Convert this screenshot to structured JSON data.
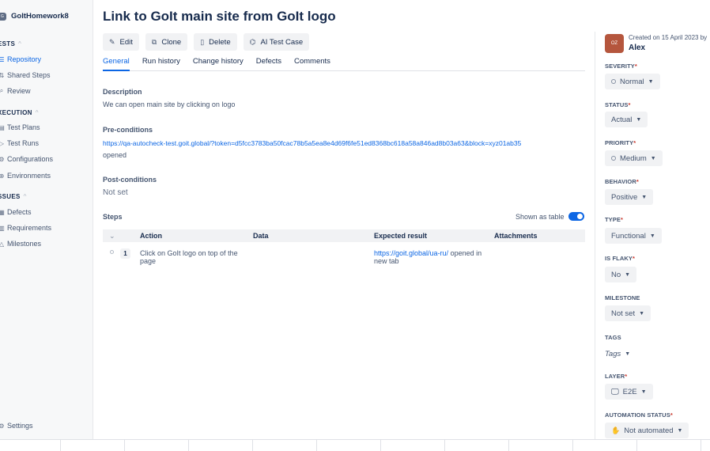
{
  "sidebar": {
    "project": {
      "badge": "G",
      "name": "GoItHomework8"
    },
    "sections": {
      "tests": "ESTS",
      "execution": "XECUTION",
      "issues": "SSUES"
    },
    "tests_items": [
      {
        "label": "Repository",
        "icon": "list-icon",
        "glyph": "☰",
        "active": true
      },
      {
        "label": "Shared Steps",
        "icon": "shared-steps-icon",
        "glyph": "⇅",
        "active": false
      },
      {
        "label": "Review",
        "icon": "review-icon",
        "glyph": "⌕",
        "active": false
      }
    ],
    "execution_items": [
      {
        "label": "Test Plans",
        "icon": "test-plans-icon",
        "glyph": "▤"
      },
      {
        "label": "Test Runs",
        "icon": "test-runs-icon",
        "glyph": "▷"
      },
      {
        "label": "Configurations",
        "icon": "configurations-icon",
        "glyph": "⚙"
      },
      {
        "label": "Environments",
        "icon": "environments-icon",
        "glyph": "⊕"
      }
    ],
    "issues_items": [
      {
        "label": "Defects",
        "icon": "defects-icon",
        "glyph": "▦"
      },
      {
        "label": "Requirements",
        "icon": "requirements-icon",
        "glyph": "▥"
      },
      {
        "label": "Milestones",
        "icon": "milestones-icon",
        "glyph": "△"
      }
    ],
    "settings": {
      "label": "Settings",
      "icon": "settings-icon",
      "glyph": "⚙"
    }
  },
  "page": {
    "title": "Link to GoIt main site from GoIt logo",
    "toolbar": {
      "edit": "Edit",
      "clone": "Clone",
      "delete": "Delete",
      "ai": "AI Test Case"
    },
    "tabs": [
      "General",
      "Run history",
      "Change history",
      "Defects",
      "Comments"
    ],
    "active_tab": "General",
    "description": {
      "label": "Description",
      "text": "We can open main site by clicking on logo"
    },
    "preconditions": {
      "label": "Pre-conditions",
      "link": "https://qa-autocheck-test.goit.global/?token=d5fcc3783ba50fcac78b5a5ea8e4d69f6fe51ed8368bc618a58a846ad8b03a63&block=xyz01ab35",
      "text": "opened"
    },
    "postconditions": {
      "label": "Post-conditions",
      "text": "Not set"
    },
    "steps": {
      "label": "Steps",
      "toggle_label": "Shown as table",
      "toggle_on": true,
      "columns": {
        "action": "Action",
        "data": "Data",
        "expected": "Expected result",
        "attachments": "Attachments"
      },
      "rows": [
        {
          "num": "1",
          "action": "Click on GoIt logo on top of the page",
          "data": "",
          "expected_link": "https://goit.global/ua-ru/",
          "expected_text": " opened in new tab"
        }
      ]
    }
  },
  "panel": {
    "avatar": "OZ",
    "created": "Created on 15 April 2023 by",
    "author": "Alex",
    "fields": {
      "severity": {
        "label": "SEVERITY",
        "value": "Normal"
      },
      "status": {
        "label": "STATUS",
        "value": "Actual"
      },
      "priority": {
        "label": "PRIORITY",
        "value": "Medium"
      },
      "behavior": {
        "label": "BEHAVIOR",
        "value": "Positive"
      },
      "type": {
        "label": "TYPE",
        "value": "Functional"
      },
      "flaky": {
        "label": "IS FLAKY",
        "value": "No"
      },
      "milestone": {
        "label": "MILESTONE",
        "value": "Not set"
      },
      "tags": {
        "label": "TAGS",
        "value": "Tags"
      },
      "layer": {
        "label": "LAYER",
        "value": "E2E"
      },
      "automation": {
        "label": "AUTOMATION STATUS",
        "value": "Not automated"
      }
    },
    "required_mark": "*"
  },
  "colors": {
    "accent": "#0c66e4",
    "avatar": "#b5563d",
    "required": "#c9372c"
  }
}
